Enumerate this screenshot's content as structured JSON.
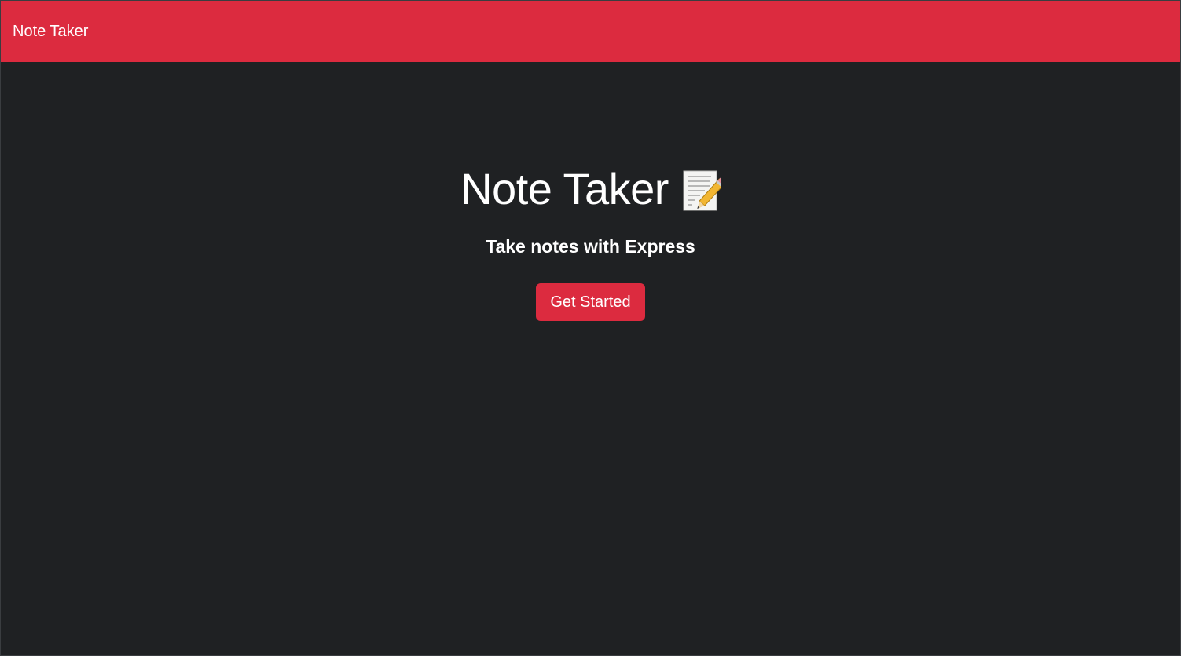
{
  "navbar": {
    "brand": "Note Taker",
    "background": "#dc2b3f"
  },
  "hero": {
    "title": "Note Taker",
    "title_icon": "memo-icon",
    "subtitle": "Take notes with Express",
    "cta_label": "Get Started"
  },
  "colors": {
    "accent": "#dc2b3f",
    "background": "#1f2123",
    "text": "#ffffff"
  }
}
